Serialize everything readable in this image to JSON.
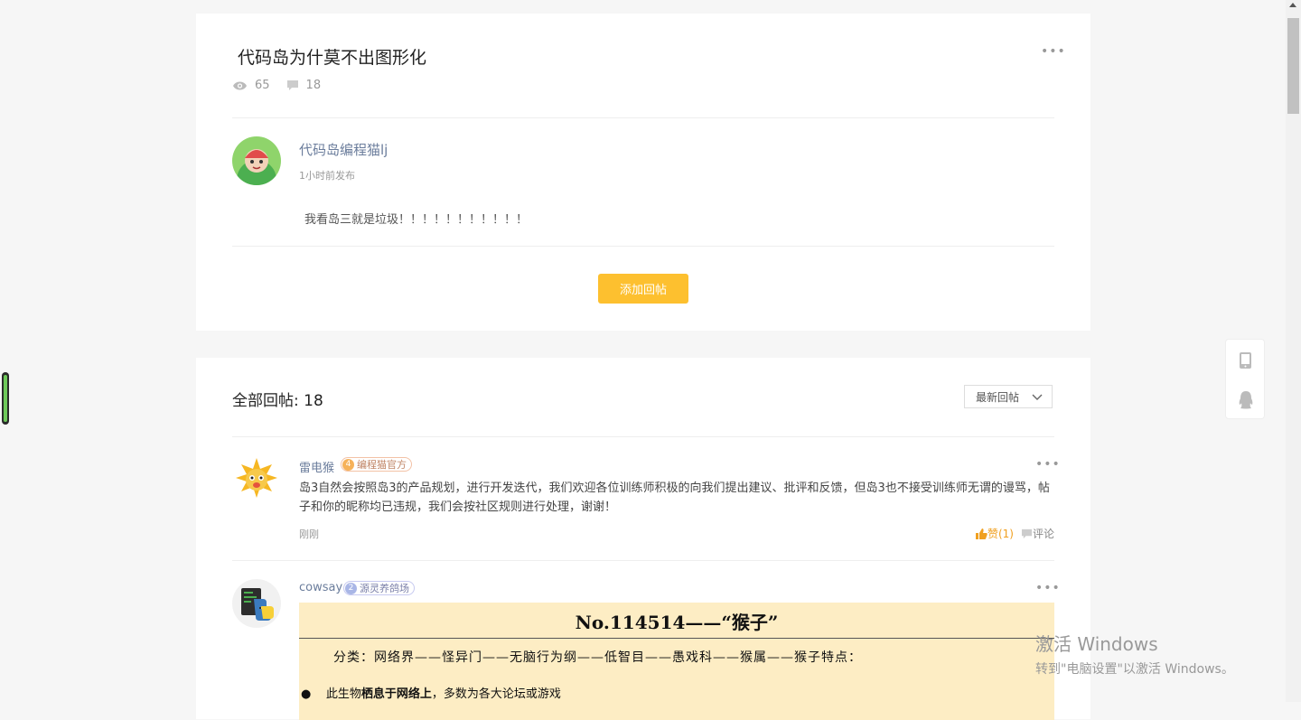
{
  "post": {
    "title": "代码岛为什莫不出图形化",
    "views": "65",
    "comments": "18",
    "author": "代码岛编程猫lj",
    "time": "1小时前发布",
    "body": "我看岛三就是垃圾！！！！！！！！！！！",
    "add_reply_label": "添加回帖"
  },
  "replies": {
    "title": "全部回帖: 18",
    "sort_label": "最新回帖",
    "items": [
      {
        "name": "雷电猴",
        "badge_level": "4",
        "badge_label": "编程猫官方",
        "text": "岛3自然会按照岛3的产品规划，进行开发迭代，我们欢迎各位训练师积极的向我们提出建议、批评和反馈，但岛3也不接受训练师无谓的谩骂，帖子和你的昵称均已违规，我们会按社区规则进行处理，谢谢！",
        "time": "刚刚",
        "like_label": "赞(1)",
        "comment_label": "评论"
      },
      {
        "name": "cowsay",
        "badge_level": "2",
        "badge_label": "源灵养鸽场",
        "image": {
          "heading": "No.114514——“猴子”",
          "line1": "分类：网络界——怪异门——无脑行为纲——低智目——愚戏科——猴属——猴子特点：",
          "bullet_prefix": "此生物",
          "bullet_bold": "栖息于网络上",
          "bullet_rest": "，多数为各大论坛或游戏"
        }
      }
    ]
  },
  "watermark": {
    "line1": "激活 Windows",
    "line2": "转到\"电脑设置\"以激活 Windows。"
  }
}
